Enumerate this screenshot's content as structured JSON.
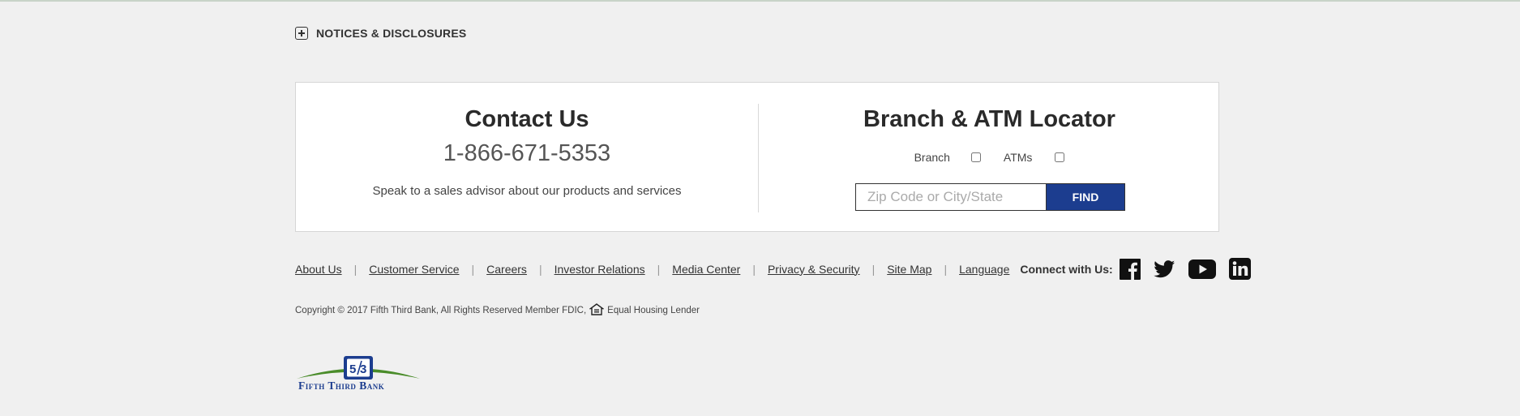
{
  "notices": {
    "label": "NOTICES & DISCLOSURES",
    "icon": "plus-square-icon"
  },
  "contact": {
    "title": "Contact Us",
    "phone": "1-866-671-5353",
    "description": "Speak to a sales advisor about our products and services"
  },
  "locator": {
    "title": "Branch & ATM Locator",
    "branch_label": "Branch",
    "atms_label": "ATMs",
    "branch_checked": false,
    "atms_checked": false,
    "search_placeholder": "Zip Code or City/State",
    "search_value": "",
    "find_label": "FIND",
    "find_color": "#1c3d8f"
  },
  "footer_links": [
    "About Us",
    "Customer Service",
    "Careers",
    "Investor Relations",
    "Media Center",
    "Privacy & Security",
    "Site Map",
    "Language"
  ],
  "connect_label": "Connect with Us:",
  "social": [
    "facebook-icon",
    "twitter-icon",
    "youtube-icon",
    "linkedin-icon"
  ],
  "copyright": {
    "text": "Copyright © 2017 Fifth Third Bank, All Rights Reserved Member FDIC,",
    "lender": "Equal Housing Lender",
    "icon": "equal-housing-icon"
  },
  "logo": {
    "brand": "Fifth Third Bank",
    "colors": {
      "green": "#4a8c2a",
      "blue": "#1c3d8f"
    }
  }
}
